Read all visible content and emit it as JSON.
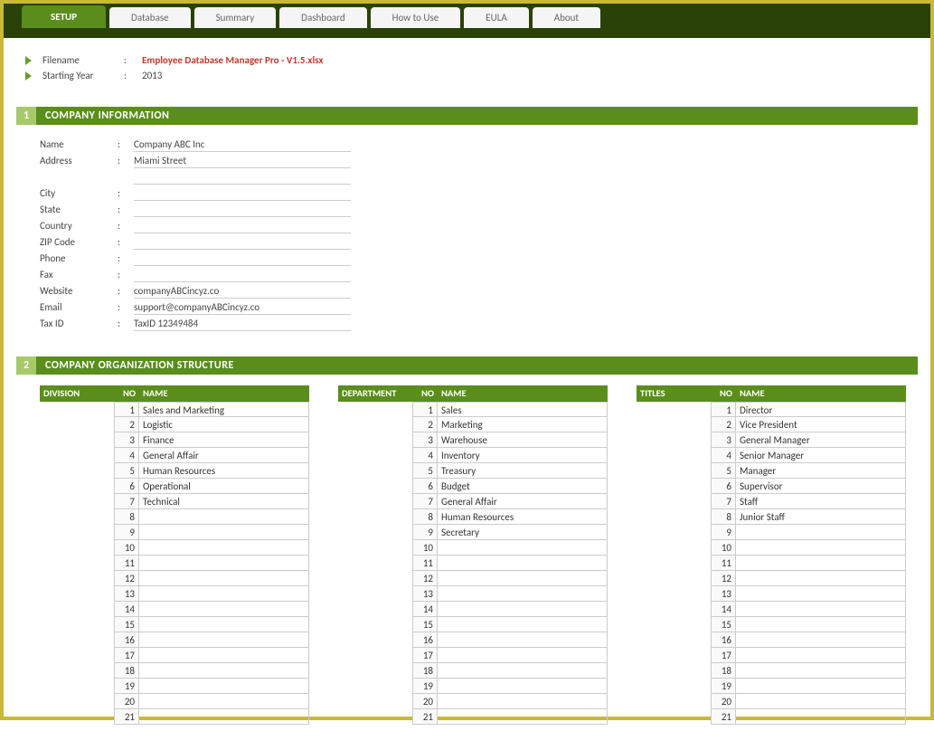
{
  "tabs": [
    "SETUP",
    "Database",
    "Summary",
    "Dashboard",
    "How to Use",
    "EULA",
    "About"
  ],
  "meta": {
    "filename_label": "Filename",
    "filename_value": "Employee Database Manager Pro - V1.5.xlsx",
    "year_label": "Starting Year",
    "year_value": "2013"
  },
  "section1": {
    "no": "1",
    "title": "COMPANY INFORMATION",
    "rows": [
      {
        "label": "Name",
        "value": "Company ABC Inc"
      },
      {
        "label": "Address",
        "value": "Miami Street"
      },
      {
        "label": "",
        "value": ""
      },
      {
        "label": "City",
        "value": ""
      },
      {
        "label": "State",
        "value": ""
      },
      {
        "label": "Country",
        "value": ""
      },
      {
        "label": "ZIP Code",
        "value": ""
      },
      {
        "label": "Phone",
        "value": ""
      },
      {
        "label": "Fax",
        "value": ""
      },
      {
        "label": "Website",
        "value": "companyABCincyz.co"
      },
      {
        "label": "Email",
        "value": "support@companyABCincyz.co"
      },
      {
        "label": "Tax ID",
        "value": "TaxID 12349484"
      }
    ]
  },
  "section2": {
    "no": "2",
    "title": "COMPANY ORGANIZATION STRUCTURE",
    "tables": [
      {
        "title": "DIVISION",
        "no_label": "NO",
        "name_label": "NAME",
        "rows": [
          {
            "no": "1",
            "name": "Sales and Marketing"
          },
          {
            "no": "2",
            "name": "Logistic"
          },
          {
            "no": "3",
            "name": "Finance"
          },
          {
            "no": "4",
            "name": "General Affair"
          },
          {
            "no": "5",
            "name": "Human Resources"
          },
          {
            "no": "6",
            "name": "Operational"
          },
          {
            "no": "7",
            "name": "Technical"
          },
          {
            "no": "8",
            "name": ""
          },
          {
            "no": "9",
            "name": ""
          },
          {
            "no": "10",
            "name": ""
          },
          {
            "no": "11",
            "name": ""
          },
          {
            "no": "12",
            "name": ""
          },
          {
            "no": "13",
            "name": ""
          },
          {
            "no": "14",
            "name": ""
          },
          {
            "no": "15",
            "name": ""
          },
          {
            "no": "16",
            "name": ""
          },
          {
            "no": "17",
            "name": ""
          },
          {
            "no": "18",
            "name": ""
          },
          {
            "no": "19",
            "name": ""
          },
          {
            "no": "20",
            "name": ""
          },
          {
            "no": "21",
            "name": ""
          }
        ]
      },
      {
        "title": "DEPARTMENT",
        "no_label": "NO",
        "name_label": "NAME",
        "rows": [
          {
            "no": "1",
            "name": "Sales"
          },
          {
            "no": "2",
            "name": "Marketing"
          },
          {
            "no": "3",
            "name": "Warehouse"
          },
          {
            "no": "4",
            "name": "Inventory"
          },
          {
            "no": "5",
            "name": "Treasury"
          },
          {
            "no": "6",
            "name": "Budget"
          },
          {
            "no": "7",
            "name": "General Affair"
          },
          {
            "no": "8",
            "name": "Human Resources"
          },
          {
            "no": "9",
            "name": "Secretary"
          },
          {
            "no": "10",
            "name": ""
          },
          {
            "no": "11",
            "name": ""
          },
          {
            "no": "12",
            "name": ""
          },
          {
            "no": "13",
            "name": ""
          },
          {
            "no": "14",
            "name": ""
          },
          {
            "no": "15",
            "name": ""
          },
          {
            "no": "16",
            "name": ""
          },
          {
            "no": "17",
            "name": ""
          },
          {
            "no": "18",
            "name": ""
          },
          {
            "no": "19",
            "name": ""
          },
          {
            "no": "20",
            "name": ""
          },
          {
            "no": "21",
            "name": ""
          }
        ]
      },
      {
        "title": "TITLES",
        "no_label": "NO",
        "name_label": "NAME",
        "rows": [
          {
            "no": "1",
            "name": "Director"
          },
          {
            "no": "2",
            "name": "Vice President"
          },
          {
            "no": "3",
            "name": "General Manager"
          },
          {
            "no": "4",
            "name": "Senior Manager"
          },
          {
            "no": "5",
            "name": "Manager"
          },
          {
            "no": "6",
            "name": "Supervisor"
          },
          {
            "no": "7",
            "name": "Staff"
          },
          {
            "no": "8",
            "name": "Junior Staff"
          },
          {
            "no": "9",
            "name": ""
          },
          {
            "no": "10",
            "name": ""
          },
          {
            "no": "11",
            "name": ""
          },
          {
            "no": "12",
            "name": ""
          },
          {
            "no": "13",
            "name": ""
          },
          {
            "no": "14",
            "name": ""
          },
          {
            "no": "15",
            "name": ""
          },
          {
            "no": "16",
            "name": ""
          },
          {
            "no": "17",
            "name": ""
          },
          {
            "no": "18",
            "name": ""
          },
          {
            "no": "19",
            "name": ""
          },
          {
            "no": "20",
            "name": ""
          },
          {
            "no": "21",
            "name": ""
          }
        ]
      }
    ]
  }
}
